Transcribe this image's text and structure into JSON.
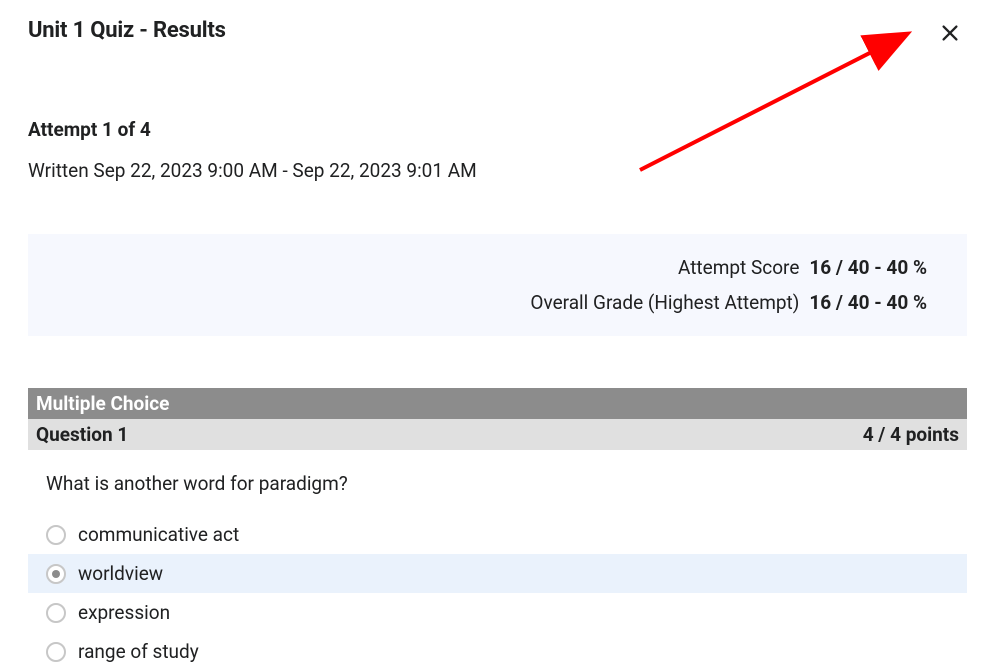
{
  "header": {
    "title": "Unit 1 Quiz - Results"
  },
  "attempt": {
    "label": "Attempt 1 of 4",
    "written": "Written Sep 22, 2023 9:00 AM - Sep 22, 2023 9:01 AM"
  },
  "scores": {
    "attempt_label": "Attempt Score",
    "attempt_value": "16 / 40 - 40 %",
    "overall_label": "Overall Grade (Highest Attempt)",
    "overall_value": "16 / 40 - 40 %"
  },
  "question": {
    "section_type": "Multiple Choice",
    "number_label": "Question 1",
    "points": "4 / 4 points",
    "text": "What is another word for paradigm?",
    "options": [
      {
        "label": "communicative act",
        "selected": false
      },
      {
        "label": "worldview",
        "selected": true
      },
      {
        "label": "expression",
        "selected": false
      },
      {
        "label": "range of study",
        "selected": false
      }
    ]
  }
}
